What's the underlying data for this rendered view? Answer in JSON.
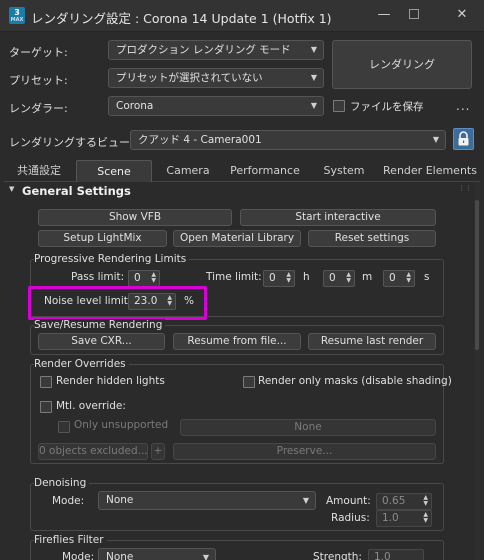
{
  "window": {
    "title": "レンダリング設定 : Corona 14 Update 1 (Hotfix 1)",
    "app_icon_text": "3",
    "app_icon_sub": "MAX"
  },
  "target": {
    "label": "ターゲット:",
    "value": "プロダクション レンダリング モード"
  },
  "preset": {
    "label": "プリセット:",
    "value": "プリセットが選択されていない"
  },
  "renderer": {
    "label": "レンダラー:",
    "value": "Corona"
  },
  "render_button": "レンダリング",
  "save_file": {
    "label": "ファイルを保存",
    "checked": false
  },
  "more": "...",
  "view": {
    "label": "レンダリングするビュー:",
    "value": "クアッド 4 - Camera001"
  },
  "tabs": [
    {
      "label": "共通設定",
      "active": false
    },
    {
      "label": "Scene",
      "active": true
    },
    {
      "label": "Camera",
      "active": false
    },
    {
      "label": "Performance",
      "active": false
    },
    {
      "label": "System",
      "active": false
    },
    {
      "label": "Render Elements",
      "active": false
    }
  ],
  "general_settings": {
    "title": "General Settings",
    "buttons": {
      "show_vfb": "Show VFB",
      "start_interactive": "Start interactive",
      "setup_lightmix": "Setup LightMix",
      "open_material_library": "Open Material Library",
      "reset_settings": "Reset settings"
    },
    "progressive": {
      "title": "Progressive Rendering Limits",
      "pass_limit_label": "Pass limit:",
      "pass_limit_value": "0",
      "time_limit_label": "Time limit:",
      "hours": "0",
      "h": "h",
      "minutes": "0",
      "m": "m",
      "seconds": "0",
      "s": "s",
      "noise_label": "Noise level limit:",
      "noise_value": "23.0",
      "noise_unit": "%"
    },
    "save_resume": {
      "title": "Save/Resume Rendering",
      "save_cxr": "Save CXR...",
      "resume_from_file": "Resume from file...",
      "resume_last": "Resume last render"
    },
    "overrides": {
      "title": "Render Overrides",
      "render_hidden_lights": "Render hidden lights",
      "render_only_masks": "Render only masks (disable shading)",
      "mtl_override": "Mtl. override:",
      "only_unsupported": "Only unsupported",
      "none_button": "None",
      "objects_excluded": "0 objects excluded...",
      "plus": "+",
      "preserve": "Preserve..."
    },
    "denoising": {
      "title": "Denoising",
      "mode_label": "Mode:",
      "mode_value": "None",
      "amount_label": "Amount:",
      "amount_value": "0.65",
      "radius_label": "Radius:",
      "radius_value": "1.0"
    },
    "fireflies": {
      "title": "Fireflies Filter",
      "mode_label": "Mode:",
      "mode_value": "None",
      "strength_label": "Strength:",
      "strength_value": "1.0"
    }
  },
  "colors": {
    "highlight": "#d800d8",
    "lock_button": "#3d6b9a"
  }
}
